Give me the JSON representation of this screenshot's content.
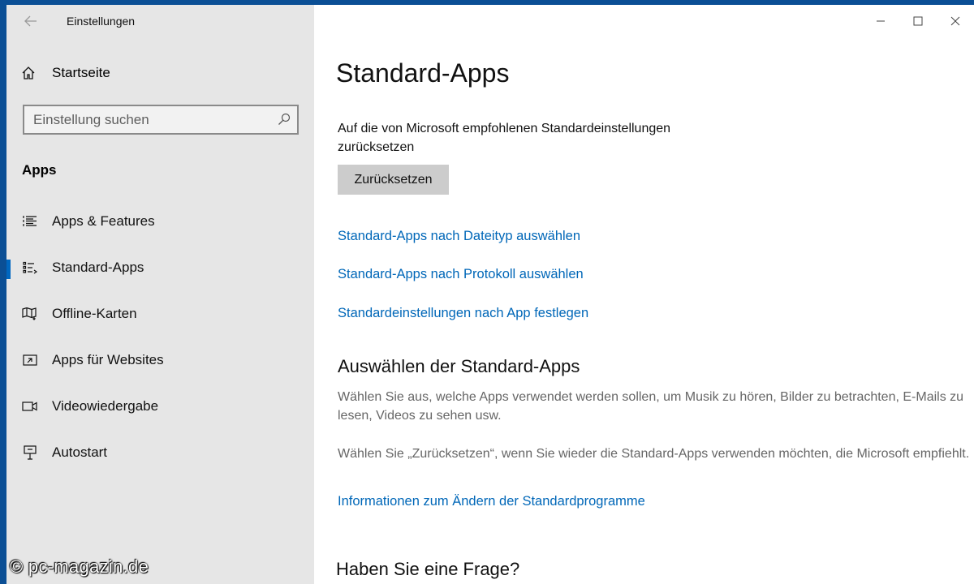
{
  "window": {
    "title": "Einstellungen",
    "controls": [
      "minimize",
      "maximize",
      "close"
    ]
  },
  "sidebar": {
    "home_label": "Startseite",
    "search": {
      "placeholder": "Einstellung suchen"
    },
    "section_title": "Apps",
    "items": [
      {
        "label": "Apps & Features",
        "icon": "apps-features-icon",
        "selected": false
      },
      {
        "label": "Standard-Apps",
        "icon": "default-apps-icon",
        "selected": true
      },
      {
        "label": "Offline-Karten",
        "icon": "offline-maps-icon",
        "selected": false
      },
      {
        "label": "Apps für Websites",
        "icon": "apps-websites-icon",
        "selected": false
      },
      {
        "label": "Videowiedergabe",
        "icon": "video-playback-icon",
        "selected": false
      },
      {
        "label": "Autostart",
        "icon": "startup-icon",
        "selected": false
      }
    ]
  },
  "main": {
    "title": "Standard-Apps",
    "reset_text": "Auf die von Microsoft empfohlenen Standardeinstellungen zurücksetzen",
    "reset_button": "Zurücksetzen",
    "links": [
      "Standard-Apps nach Dateityp auswählen",
      "Standard-Apps nach Protokoll auswählen",
      "Standardeinstellungen nach App festlegen"
    ],
    "choose_heading": "Auswählen der Standard-Apps",
    "choose_paragraph_1": "Wählen Sie aus, welche Apps verwendet werden sollen, um Musik zu hören, Bilder zu betrachten, E-Mails zu lesen, Videos zu sehen usw.",
    "choose_paragraph_2": "Wählen Sie „Zurücksetzen“, wenn Sie wieder die Standard-Apps verwenden möchten, die Microsoft empfiehlt.",
    "info_link": "Informationen zum Ändern der Standardprogramme",
    "faq_heading": "Haben Sie eine Frage?"
  },
  "watermark": "© pc-magazin.de",
  "colors": {
    "accent": "#0067b8",
    "sidebar_bg": "#e6e6e6",
    "button_bg": "#cccccc"
  }
}
